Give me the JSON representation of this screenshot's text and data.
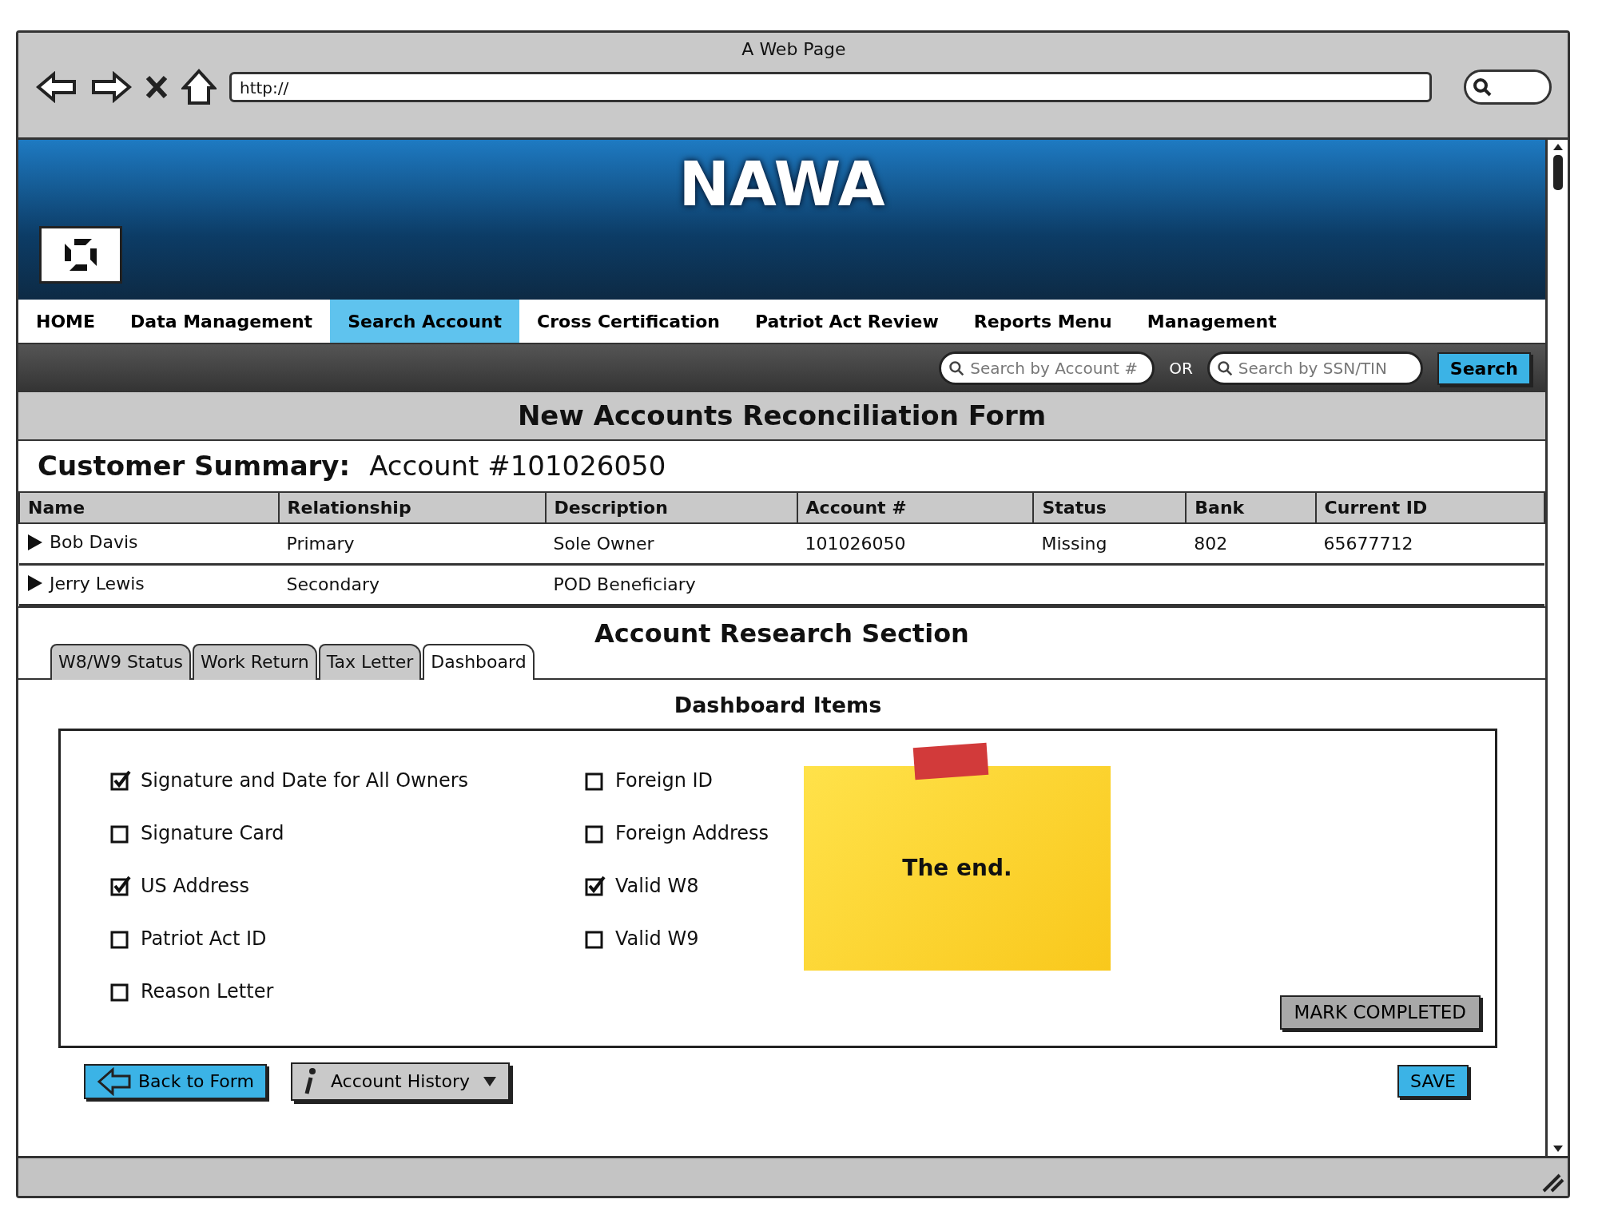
{
  "window": {
    "title": "A Web Page",
    "address": "http://"
  },
  "header": {
    "title": "NAWA"
  },
  "nav": [
    {
      "label": "HOME",
      "selected": false
    },
    {
      "label": "Data Management",
      "selected": false
    },
    {
      "label": "Search Account",
      "selected": true
    },
    {
      "label": "Cross Certification",
      "selected": false
    },
    {
      "label": "Patriot Act Review",
      "selected": false
    },
    {
      "label": "Reports Menu",
      "selected": false
    },
    {
      "label": "Management",
      "selected": false
    }
  ],
  "search": {
    "account_placeholder": "Search by Account #",
    "or": "OR",
    "ssn_placeholder": "Search by SSN/TIN",
    "button": "Search"
  },
  "form_title": "New Accounts Reconciliation Form",
  "summary": {
    "label": "Customer Summary:",
    "account": "Account #101026050"
  },
  "table": {
    "columns": [
      "Name",
      "Relationship",
      "Description",
      "Account #",
      "Status",
      "Bank",
      "Current ID"
    ],
    "rows": [
      [
        "Bob Davis",
        "Primary",
        "Sole Owner",
        "101026050",
        "Missing",
        "802",
        "65677712"
      ],
      [
        "Jerry Lewis",
        "Secondary",
        "POD Beneficiary",
        "",
        "",
        "",
        ""
      ]
    ]
  },
  "research": {
    "title": "Account Research Section",
    "tabs": [
      {
        "label": "W8/W9 Status",
        "selected": false
      },
      {
        "label": "Work Return",
        "selected": false
      },
      {
        "label": "Tax Letter",
        "selected": false
      },
      {
        "label": "Dashboard",
        "selected": true
      }
    ],
    "items_title": "Dashboard Items",
    "checklist": [
      [
        {
          "label": "Signature and Date for All Owners",
          "checked": true
        },
        {
          "label": "Signature Card",
          "checked": false
        },
        {
          "label": "US Address",
          "checked": true
        },
        {
          "label": "Patriot Act ID",
          "checked": false
        },
        {
          "label": "Reason Letter",
          "checked": false
        }
      ],
      [
        {
          "label": "Foreign ID",
          "checked": false
        },
        {
          "label": "Foreign Address",
          "checked": false
        },
        {
          "label": "Valid W8",
          "checked": true
        },
        {
          "label": "Valid W9",
          "checked": false
        }
      ]
    ],
    "note": "The end.",
    "mark_completed": "MARK COMPLETED"
  },
  "buttons": {
    "back": "Back to Form",
    "history": "Account History",
    "save": "SAVE"
  }
}
